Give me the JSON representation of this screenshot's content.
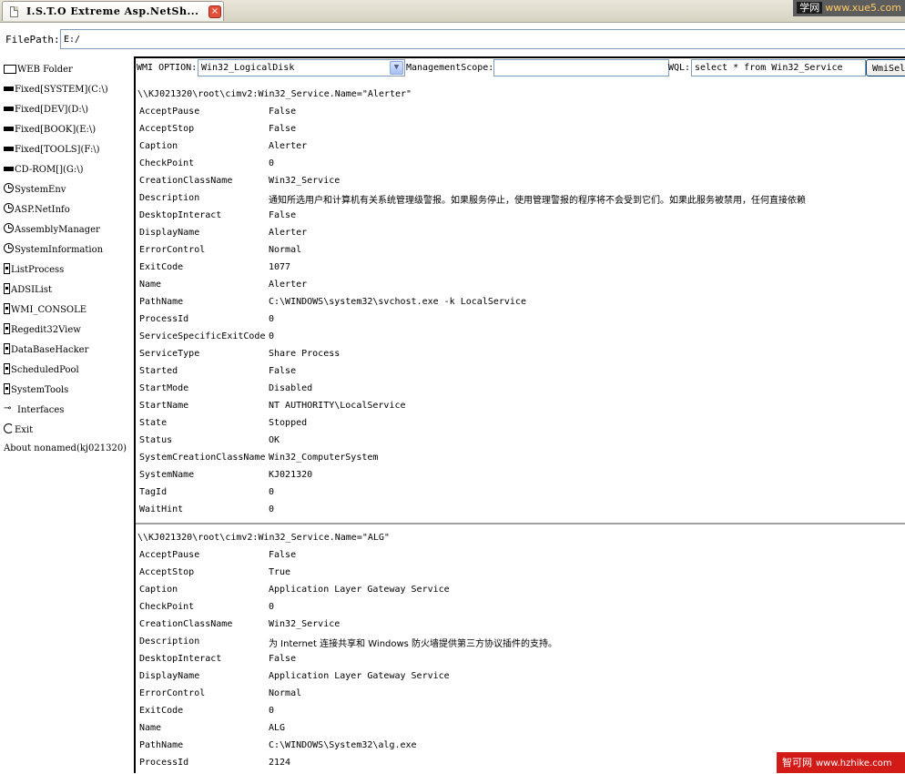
{
  "tab": {
    "title": "I.S.T.O Extreme Asp.NetSh...",
    "close_symbol": "×"
  },
  "watermarks": {
    "top_site": "学网",
    "top_url": "www.xue5.com",
    "bottom_site": "智可网",
    "bottom_url": "www.hzhike.com"
  },
  "filepath": {
    "label": "FilePath:",
    "value": "E:/"
  },
  "sidebar": {
    "items": [
      {
        "icon": "folder-icon",
        "label": "WEB Folder"
      },
      {
        "icon": "drive-icon",
        "label": "Fixed[SYSTEM](C:\\)"
      },
      {
        "icon": "drive-icon",
        "label": "Fixed[DEV](D:\\)"
      },
      {
        "icon": "drive-icon",
        "label": "Fixed[BOOK](E:\\)"
      },
      {
        "icon": "drive-icon",
        "label": "Fixed[TOOLS](F:\\)"
      },
      {
        "icon": "cdrom-icon",
        "label": "CD-ROM[](G:\\)"
      },
      {
        "icon": "clock-icon",
        "label": "SystemEnv"
      },
      {
        "icon": "clock-icon",
        "label": "ASP.NetInfo"
      },
      {
        "icon": "clock-icon",
        "label": "AssemblyManager"
      },
      {
        "icon": "clock-icon",
        "label": "SystemInformation"
      },
      {
        "icon": "tool-icon",
        "label": "ListProcess"
      },
      {
        "icon": "tool-icon",
        "label": "ADSIList"
      },
      {
        "icon": "tool-icon",
        "label": "WMI_CONSOLE"
      },
      {
        "icon": "tool-icon",
        "label": "Regedit32View"
      },
      {
        "icon": "tool-icon",
        "label": "DataBaseHacker"
      },
      {
        "icon": "tool-icon",
        "label": "ScheduledPool"
      },
      {
        "icon": "tool-icon",
        "label": "SystemTools"
      },
      {
        "icon": "plug-icon",
        "label": "Interfaces"
      },
      {
        "icon": "exit-icon",
        "label": "Exit"
      },
      {
        "icon": "",
        "label": "About nonamed(kj021320)"
      }
    ]
  },
  "toolbar": {
    "wmi_option_label": "WMI OPTION:",
    "wmi_option_value": "Win32_LogicalDisk",
    "scope_label": "ManagementScope:",
    "scope_value": "",
    "wql_label": "WQL:",
    "wql_value": "select * from Win32_Service",
    "button_label": "WmiSel"
  },
  "results": [
    {
      "path": "\\\\KJ021320\\root\\cimv2:Win32_Service.Name=\"Alerter\"",
      "props": [
        {
          "k": "AcceptPause",
          "v": "False"
        },
        {
          "k": "AcceptStop",
          "v": "False"
        },
        {
          "k": "Caption",
          "v": "Alerter"
        },
        {
          "k": "CheckPoint",
          "v": "0"
        },
        {
          "k": "CreationClassName",
          "v": "Win32_Service"
        },
        {
          "k": "Description",
          "v": "通知所选用户和计算机有关系统管理级警报。如果服务停止，使用管理警报的程序将不会受到它们。如果此服务被禁用，任何直接依赖"
        },
        {
          "k": "DesktopInteract",
          "v": "False"
        },
        {
          "k": "DisplayName",
          "v": "Alerter"
        },
        {
          "k": "ErrorControl",
          "v": "Normal"
        },
        {
          "k": "ExitCode",
          "v": "1077"
        },
        {
          "k": "Name",
          "v": "Alerter"
        },
        {
          "k": "PathName",
          "v": "C:\\WINDOWS\\system32\\svchost.exe -k LocalService"
        },
        {
          "k": "ProcessId",
          "v": "0"
        },
        {
          "k": "ServiceSpecificExitCode",
          "v": "0"
        },
        {
          "k": "ServiceType",
          "v": "Share Process"
        },
        {
          "k": "Started",
          "v": "False"
        },
        {
          "k": "StartMode",
          "v": "Disabled"
        },
        {
          "k": "StartName",
          "v": "NT AUTHORITY\\LocalService"
        },
        {
          "k": "State",
          "v": "Stopped"
        },
        {
          "k": "Status",
          "v": "OK"
        },
        {
          "k": "SystemCreationClassName",
          "v": "Win32_ComputerSystem"
        },
        {
          "k": "SystemName",
          "v": "KJ021320"
        },
        {
          "k": "TagId",
          "v": "0"
        },
        {
          "k": "WaitHint",
          "v": "0"
        }
      ]
    },
    {
      "path": "\\\\KJ021320\\root\\cimv2:Win32_Service.Name=\"ALG\"",
      "props": [
        {
          "k": "AcceptPause",
          "v": "False"
        },
        {
          "k": "AcceptStop",
          "v": "True"
        },
        {
          "k": "Caption",
          "v": "Application Layer Gateway Service"
        },
        {
          "k": "CheckPoint",
          "v": "0"
        },
        {
          "k": "CreationClassName",
          "v": "Win32_Service"
        },
        {
          "k": "Description",
          "v": "为 Internet 连接共享和 Windows 防火墙提供第三方协议插件的支持。"
        },
        {
          "k": "DesktopInteract",
          "v": "False"
        },
        {
          "k": "DisplayName",
          "v": "Application Layer Gateway Service"
        },
        {
          "k": "ErrorControl",
          "v": "Normal"
        },
        {
          "k": "ExitCode",
          "v": "0"
        },
        {
          "k": "Name",
          "v": "ALG"
        },
        {
          "k": "PathName",
          "v": "C:\\WINDOWS\\System32\\alg.exe"
        },
        {
          "k": "ProcessId",
          "v": "2124"
        }
      ]
    }
  ]
}
